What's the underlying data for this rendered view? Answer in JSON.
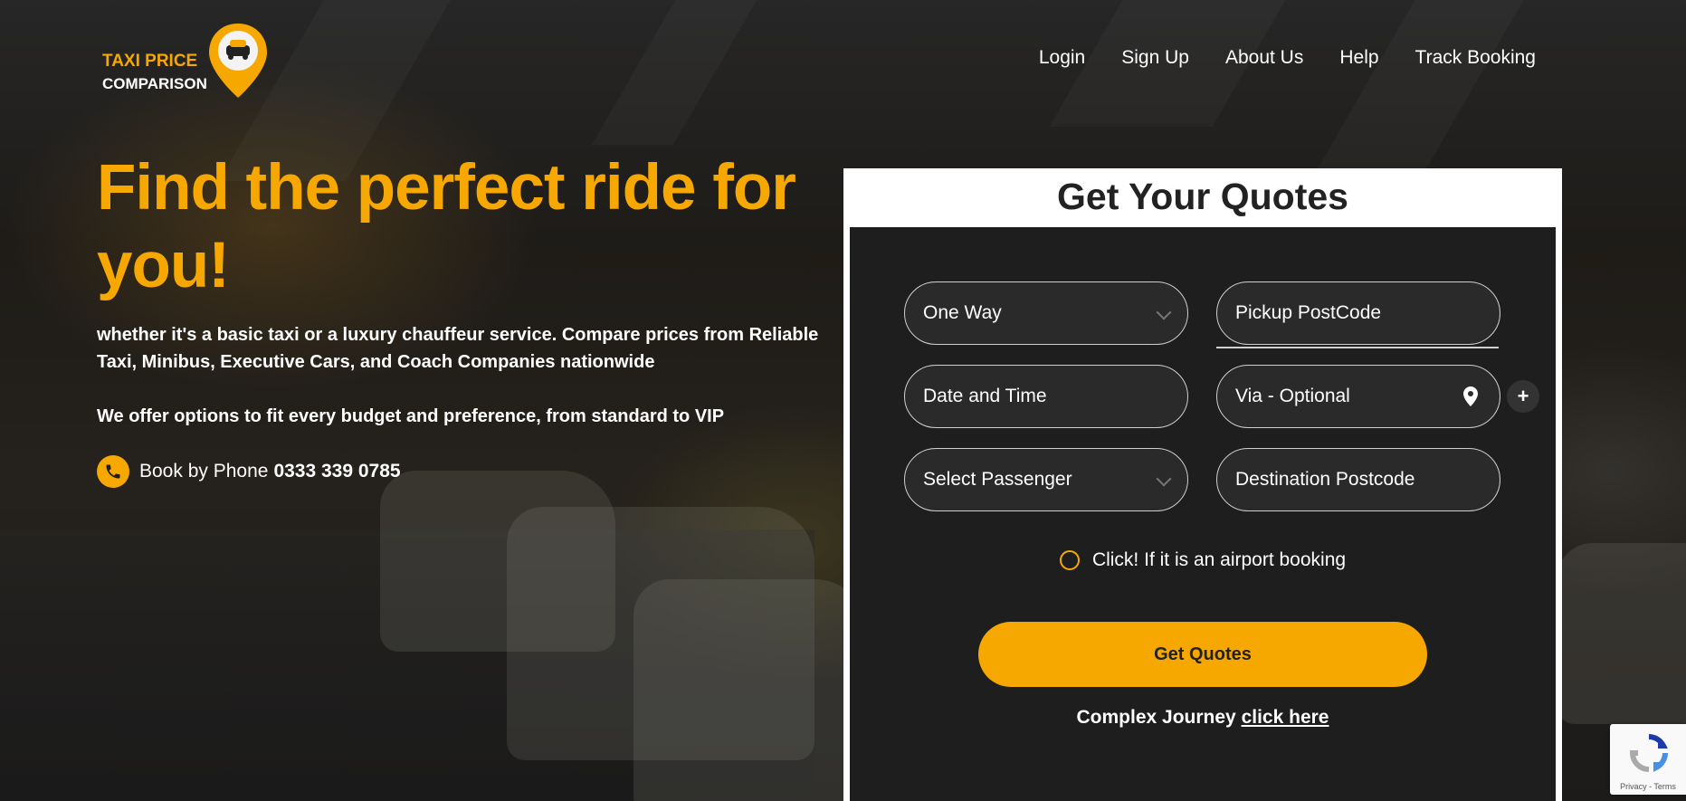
{
  "brand": {
    "line1": "TAXI PRICE",
    "line2": "COMPARISON",
    "accent": "#f7a800"
  },
  "nav": [
    {
      "label": "Login"
    },
    {
      "label": "Sign Up"
    },
    {
      "label": "About Us"
    },
    {
      "label": "Help"
    },
    {
      "label": "Track Booking"
    }
  ],
  "hero": {
    "title": "Find the perfect ride for you!",
    "subtitle": "whether it's a basic taxi or a luxury chauffeur service. Compare prices from Reliable Taxi, Minibus, Executive Cars, and Coach Companies nationwide",
    "tagline": "We offer options to fit every budget and preference, from standard to VIP",
    "phone_prefix": "Book by Phone",
    "phone_number": "0333 339 0785",
    "phone_icon": "phone-icon"
  },
  "quote_form": {
    "title": "Get Your Quotes",
    "trip_type": "One Way",
    "pickup_placeholder": "Pickup PostCode",
    "datetime_placeholder": "Date and Time",
    "via_placeholder": "Via - Optional",
    "passenger_placeholder": "Select Passenger",
    "destination_placeholder": "Destination Postcode",
    "add_via_label": "+",
    "airport_label": "Click! If it is an airport booking",
    "submit_label": "Get Quotes",
    "complex_prefix": "Complex Journey",
    "complex_link": "click here"
  },
  "recaptcha": {
    "terms": "Privacy - Terms"
  }
}
